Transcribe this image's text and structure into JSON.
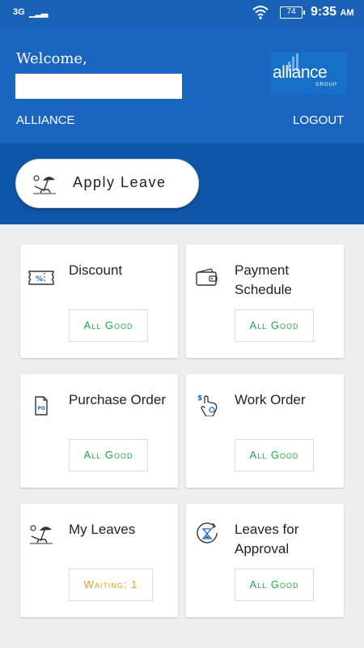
{
  "status_bar": {
    "network": "3G",
    "battery": "74",
    "time": "9:35",
    "ampm": "AM"
  },
  "header": {
    "welcome": "Welcome,",
    "org_label": "ALLIANCE",
    "logout_label": "LOGOUT",
    "logo_text": "alliance",
    "logo_sub": "GROUP"
  },
  "apply_leave": {
    "label": "Apply Leave"
  },
  "cards": [
    {
      "title": "Discount",
      "status": "All Good"
    },
    {
      "title": "Payment Schedule",
      "status": "All Good"
    },
    {
      "title": "Purchase Order",
      "status": "All Good"
    },
    {
      "title": "Work Order",
      "status": "All Good"
    },
    {
      "title": "My Leaves",
      "status": "Waiting: 1"
    },
    {
      "title": "Leaves for Approval",
      "status": "All Good"
    }
  ],
  "icons": [
    "discount-ticket-icon",
    "wallet-icon",
    "po-document-icon",
    "work-order-icon",
    "beach-umbrella-icon",
    "hourglass-refresh-icon"
  ],
  "colors": {
    "primary": "#1a65c0",
    "band": "#0f55a8",
    "good": "#22a844",
    "waiting": "#e59a1a",
    "background": "#eceff1"
  }
}
